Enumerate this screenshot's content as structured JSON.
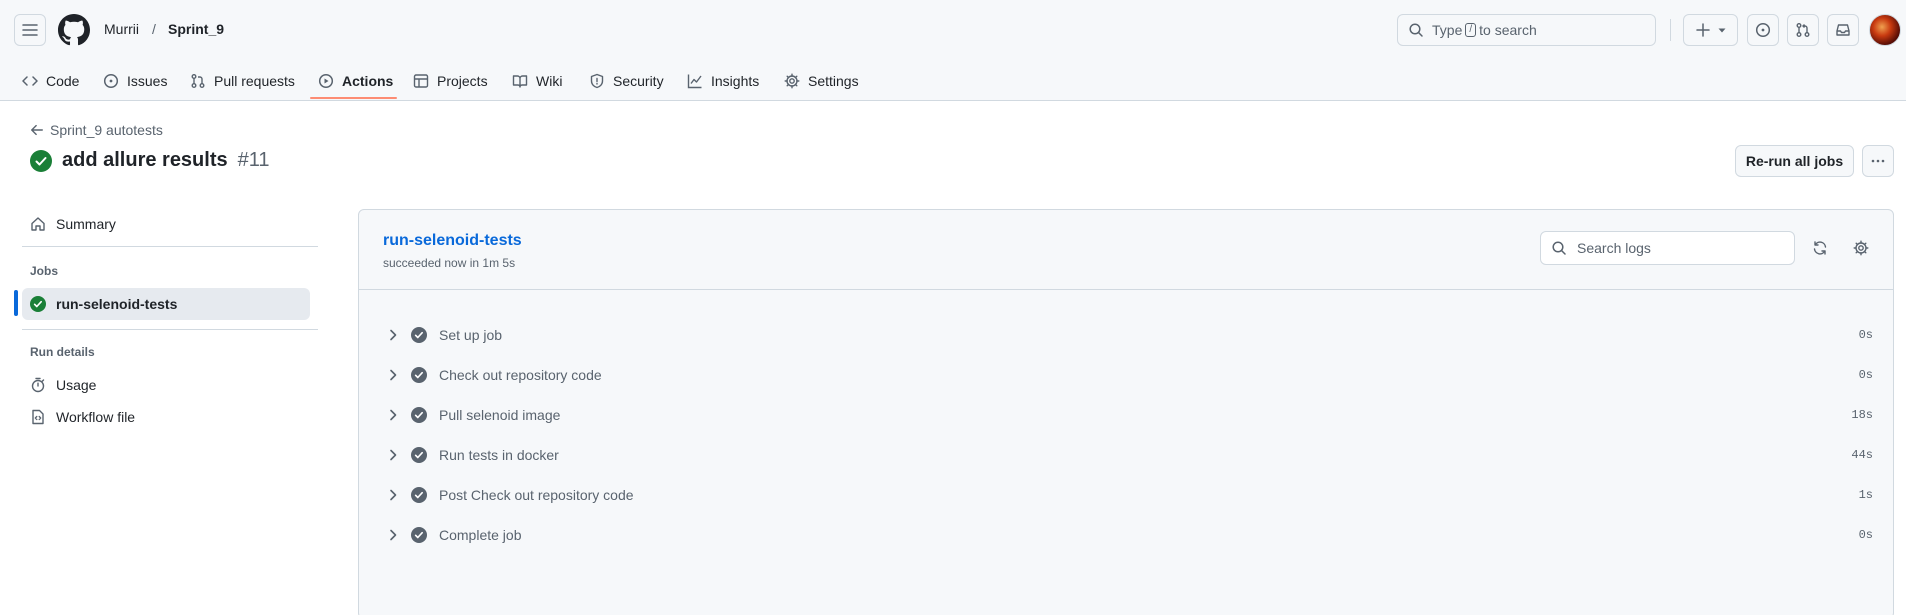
{
  "header": {
    "owner": "Murrii",
    "separator": "/",
    "repo": "Sprint_9",
    "search": {
      "before": "Type",
      "key": "/",
      "after": "to search"
    }
  },
  "tabs": [
    {
      "label": "Code",
      "icon": "code-icon"
    },
    {
      "label": "Issues",
      "icon": "issue-icon"
    },
    {
      "label": "Pull requests",
      "icon": "pull-request-icon"
    },
    {
      "label": "Actions",
      "icon": "play-icon",
      "active": true
    },
    {
      "label": "Projects",
      "icon": "table-icon"
    },
    {
      "label": "Wiki",
      "icon": "book-icon"
    },
    {
      "label": "Security",
      "icon": "shield-icon"
    },
    {
      "label": "Insights",
      "icon": "graph-icon"
    },
    {
      "label": "Settings",
      "icon": "gear-icon"
    }
  ],
  "run": {
    "back_label": "Sprint_9 autotests",
    "title": "add allure results",
    "number": "#11",
    "rerun_label": "Re-run all jobs"
  },
  "sidebar": {
    "summary": "Summary",
    "jobs_heading": "Jobs",
    "job": "run-selenoid-tests",
    "details_heading": "Run details",
    "usage": "Usage",
    "workflow_file": "Workflow file"
  },
  "job": {
    "name": "run-selenoid-tests",
    "status": "succeeded now in 1m 5s",
    "search_placeholder": "Search logs",
    "steps": [
      {
        "label": "Set up job",
        "duration": "0s"
      },
      {
        "label": "Check out repository code",
        "duration": "0s"
      },
      {
        "label": "Pull selenoid image",
        "duration": "18s"
      },
      {
        "label": "Run tests in docker",
        "duration": "44s"
      },
      {
        "label": "Post Check out repository code",
        "duration": "1s"
      },
      {
        "label": "Complete job",
        "duration": "0s"
      }
    ]
  },
  "colors": {
    "success": "#1a7f37",
    "accent": "#0969da",
    "tab_underline": "#fd8c73",
    "step_check": "#59636e"
  }
}
